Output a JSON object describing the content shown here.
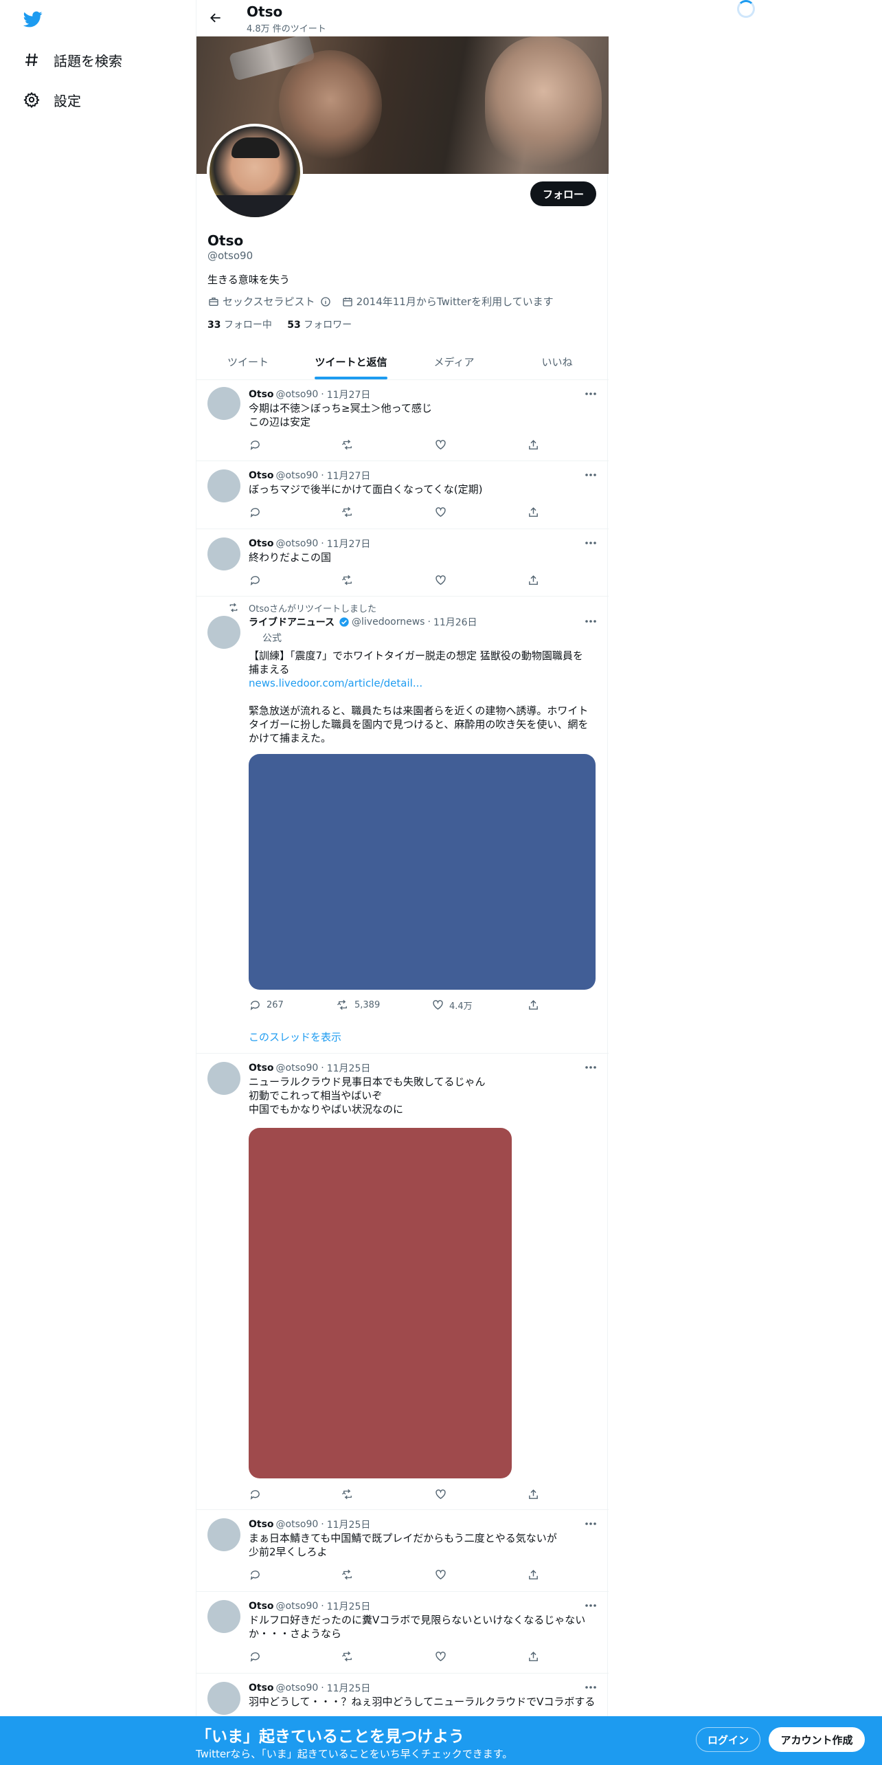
{
  "nav": {
    "explore_label": "話題を検索",
    "settings_label": "設定"
  },
  "header": {
    "name": "Otso",
    "tweet_count": "4.8万 件のツイート"
  },
  "profile": {
    "follow_button": "フォロー",
    "name": "Otso",
    "handle": "@otso90",
    "bio": "生きる意味を失う",
    "category": "セックスセラピスト",
    "joined": "2014年11月からTwitterを利用しています",
    "following_count": "33",
    "following_label": "フォロー中",
    "followers_count": "53",
    "followers_label": "フォロワー"
  },
  "tabs": [
    {
      "label": "ツイート"
    },
    {
      "label": "ツイートと返信"
    },
    {
      "label": "メディア"
    },
    {
      "label": "いいね"
    }
  ],
  "tweets": [
    {
      "name": "Otso",
      "handle": "@otso90",
      "sep": "·",
      "date": "11月27日",
      "lines": [
        "今期は不徳＞ぼっち≥冥土＞他って感じ",
        "この辺は安定"
      ]
    },
    {
      "name": "Otso",
      "handle": "@otso90",
      "sep": "·",
      "date": "11月27日",
      "lines": [
        "ぼっちマジで後半にかけて面白くなってくな(定期)"
      ]
    },
    {
      "name": "Otso",
      "handle": "@otso90",
      "sep": "·",
      "date": "11月27日",
      "lines": [
        "終わりだよこの国"
      ]
    },
    {
      "retweet_label": "Otsoさんがリツイートしました",
      "name": "ライブドアニュース",
      "handle": "@livedoornews",
      "sep": "·",
      "date": "11月26日",
      "official": "公式",
      "lines": [
        "【訓練】「震度7」でホワイトタイガー脱走の想定 猛獣役の動物園職員を",
        "捕まえる"
      ],
      "link": "news.livedoor.com/article/detail...",
      "lines2": [
        "緊急放送が流れると、職員たちは来園者らを近くの建物へ誘導。ホワイト",
        "タイガーに扮した職員を園内で見つけると、麻酔用の吹き矢を使い、網を",
        "かけて捕まえた。"
      ],
      "media_color": "#415e96",
      "replies": "267",
      "retweets": "5,389",
      "likes": "4.4万",
      "thread_link": "このスレッドを表示"
    },
    {
      "name": "Otso",
      "handle": "@otso90",
      "sep": "·",
      "date": "11月25日",
      "lines": [
        "ニューラルクラウド見事日本でも失敗してるじゃん",
        "初動でこれって相当やばいぞ",
        "中国でもかなりやばい状況なのに"
      ],
      "media_color": "#9f4a4c"
    },
    {
      "name": "Otso",
      "handle": "@otso90",
      "sep": "·",
      "date": "11月25日",
      "lines": [
        "まぁ日本鯖きても中国鯖で既プレイだからもう二度とやる気ないが",
        "少前2早くしろよ"
      ]
    },
    {
      "name": "Otso",
      "handle": "@otso90",
      "sep": "·",
      "date": "11月25日",
      "lines": [
        "ドルフロ好きだったのに糞Vコラボで見限らないといけなくなるじゃない",
        "か・・・さようなら"
      ]
    },
    {
      "name": "Otso",
      "handle": "@otso90",
      "sep": "·",
      "date": "11月25日",
      "lines": [
        "羽中どうして・・・？ねぇ羽中どうしてニューラルクラウドでVコラボする"
      ]
    }
  ],
  "bottom_bar": {
    "title": "「いま」起きていることを見つけよう",
    "subtitle": "Twitterなら、「いま」起きていることをいち早くチェックできます。",
    "login": "ログイン",
    "signup": "アカウント作成"
  },
  "colors": {
    "accent": "#1d9bf0",
    "text": "#0f1419",
    "secondary": "#536471"
  }
}
